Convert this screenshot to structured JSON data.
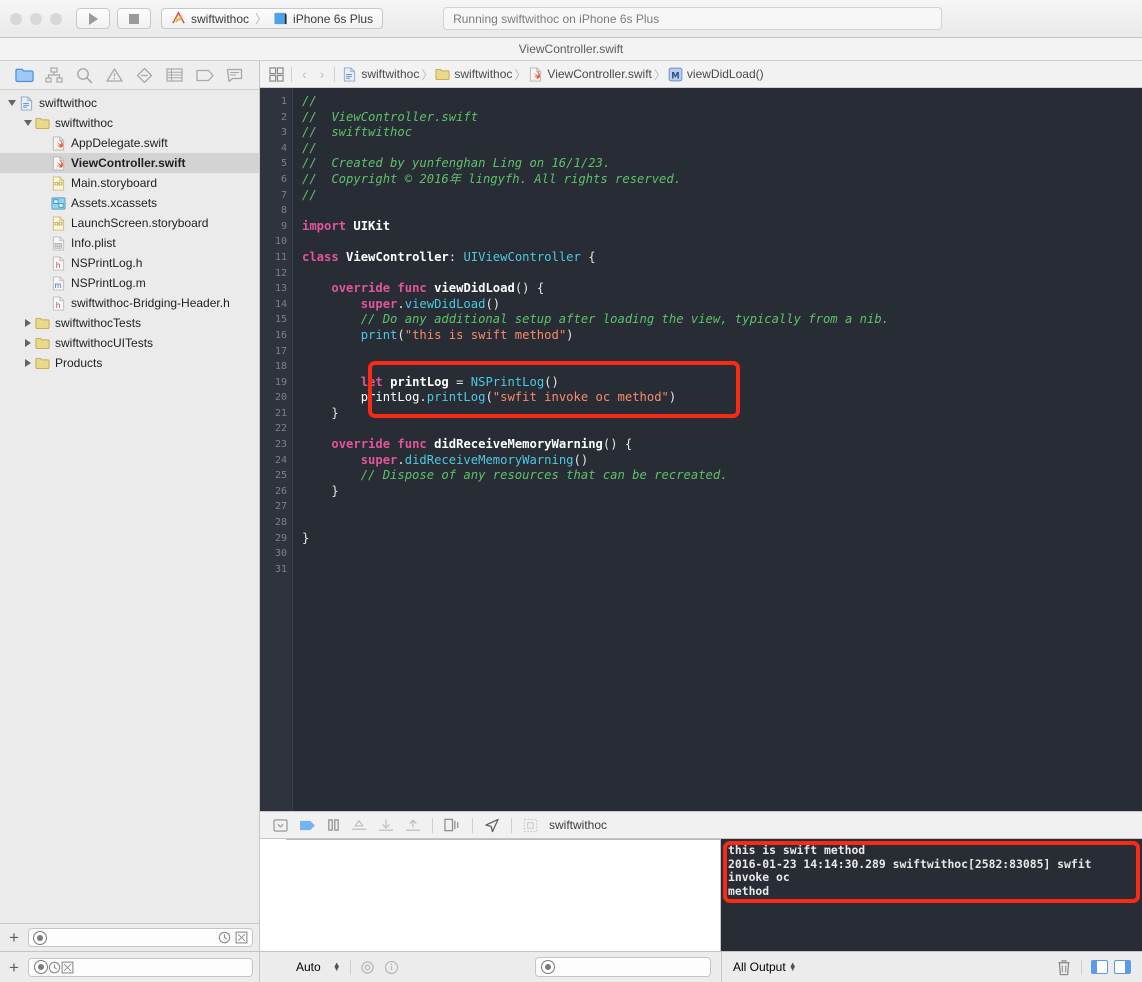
{
  "toolbar": {
    "run_button": "run-button",
    "stop_button": "stop-button",
    "scheme_name": "swiftwithoc",
    "scheme_separator": "〉",
    "destination": "iPhone 6s Plus",
    "status_text": "Running swiftwithoc on iPhone 6s Plus"
  },
  "document_title": "ViewController.swift",
  "navigator": {
    "tabs": [
      {
        "name": "project-navigator",
        "icon": "folder-icon",
        "active": true
      },
      {
        "name": "symbol-navigator",
        "icon": "hierarchy-icon",
        "active": false
      },
      {
        "name": "find-navigator",
        "icon": "search-icon",
        "active": false
      },
      {
        "name": "issue-navigator",
        "icon": "warning-triangle-icon",
        "active": false
      },
      {
        "name": "test-navigator",
        "icon": "diamond-icon",
        "active": false
      },
      {
        "name": "debug-navigator",
        "icon": "list-icon",
        "active": false
      },
      {
        "name": "breakpoint-navigator",
        "icon": "tag-icon",
        "active": false
      },
      {
        "name": "report-navigator",
        "icon": "speech-bubble-icon",
        "active": false
      }
    ],
    "tree": [
      {
        "label": "swiftwithoc",
        "indent": 0,
        "twisty": "open",
        "icon": "project-icon",
        "selected": false
      },
      {
        "label": "swiftwithoc",
        "indent": 1,
        "twisty": "open",
        "icon": "folder-icon",
        "selected": false
      },
      {
        "label": "AppDelegate.swift",
        "indent": 2,
        "twisty": "none",
        "icon": "swift-file-icon",
        "selected": false
      },
      {
        "label": "ViewController.swift",
        "indent": 2,
        "twisty": "none",
        "icon": "swift-file-icon",
        "selected": true
      },
      {
        "label": "Main.storyboard",
        "indent": 2,
        "twisty": "none",
        "icon": "storyboard-icon",
        "selected": false
      },
      {
        "label": "Assets.xcassets",
        "indent": 2,
        "twisty": "none",
        "icon": "assets-icon",
        "selected": false
      },
      {
        "label": "LaunchScreen.storyboard",
        "indent": 2,
        "twisty": "none",
        "icon": "storyboard-icon",
        "selected": false
      },
      {
        "label": "Info.plist",
        "indent": 2,
        "twisty": "none",
        "icon": "plist-icon",
        "selected": false
      },
      {
        "label": "NSPrintLog.h",
        "indent": 2,
        "twisty": "none",
        "icon": "header-file-icon",
        "selected": false
      },
      {
        "label": "NSPrintLog.m",
        "indent": 2,
        "twisty": "none",
        "icon": "objc-file-icon",
        "selected": false
      },
      {
        "label": "swiftwithoc-Bridging-Header.h",
        "indent": 2,
        "twisty": "none",
        "icon": "header-file-icon",
        "selected": false
      },
      {
        "label": "swiftwithocTests",
        "indent": 1,
        "twisty": "closed",
        "icon": "folder-icon",
        "selected": false
      },
      {
        "label": "swiftwithocUITests",
        "indent": 1,
        "twisty": "closed",
        "icon": "folder-icon",
        "selected": false
      },
      {
        "label": "Products",
        "indent": 1,
        "twisty": "closed",
        "icon": "folder-icon",
        "selected": false
      }
    ],
    "filter_placeholder": "",
    "add_button": "+"
  },
  "jumpbar": {
    "related_items_icon": "related-items-icon",
    "back_arrow": "‹",
    "forward_arrow": "›",
    "crumbs": [
      {
        "label": "swiftwithoc",
        "icon": "project-icon"
      },
      {
        "label": "swiftwithoc",
        "icon": "folder-icon"
      },
      {
        "label": "ViewController.swift",
        "icon": "swift-file-icon"
      },
      {
        "label": "viewDidLoad()",
        "icon": "method-icon"
      }
    ]
  },
  "editor": {
    "line_count": 31,
    "lines": [
      [
        {
          "t": "//",
          "c": "cm"
        }
      ],
      [
        {
          "t": "//  ViewController.swift",
          "c": "cm"
        }
      ],
      [
        {
          "t": "//  swiftwithoc",
          "c": "cm"
        }
      ],
      [
        {
          "t": "//",
          "c": "cm"
        }
      ],
      [
        {
          "t": "//  Created by yunfenghan Ling on 16/1/23.",
          "c": "cm"
        }
      ],
      [
        {
          "t": "//  Copyright © 2016年 lingyfh. All rights reserved.",
          "c": "cm"
        }
      ],
      [
        {
          "t": "//",
          "c": "cm"
        }
      ],
      [],
      [
        {
          "t": "import",
          "c": "kw"
        },
        {
          "t": " ",
          "c": "pl"
        },
        {
          "t": "UIKit",
          "c": "fn"
        }
      ],
      [],
      [
        {
          "t": "class",
          "c": "kw"
        },
        {
          "t": " ",
          "c": "pl"
        },
        {
          "t": "ViewController",
          "c": "fn"
        },
        {
          "t": ": ",
          "c": "pl"
        },
        {
          "t": "UIViewController",
          "c": "ty"
        },
        {
          "t": " {",
          "c": "pl"
        }
      ],
      [],
      [
        {
          "t": "    ",
          "c": "pl"
        },
        {
          "t": "override",
          "c": "kw"
        },
        {
          "t": " ",
          "c": "pl"
        },
        {
          "t": "func",
          "c": "kw"
        },
        {
          "t": " ",
          "c": "pl"
        },
        {
          "t": "viewDidLoad",
          "c": "fn"
        },
        {
          "t": "() {",
          "c": "pl"
        }
      ],
      [
        {
          "t": "        ",
          "c": "pl"
        },
        {
          "t": "super",
          "c": "kw"
        },
        {
          "t": ".",
          "c": "pl"
        },
        {
          "t": "viewDidLoad",
          "c": "ty"
        },
        {
          "t": "()",
          "c": "pl"
        }
      ],
      [
        {
          "t": "        // Do any additional setup after loading the view, typically from a nib.",
          "c": "cm"
        }
      ],
      [
        {
          "t": "        ",
          "c": "pl"
        },
        {
          "t": "print",
          "c": "ty"
        },
        {
          "t": "(",
          "c": "pl"
        },
        {
          "t": "\"this is swift method\"",
          "c": "st"
        },
        {
          "t": ")",
          "c": "pl"
        }
      ],
      [],
      [],
      [
        {
          "t": "        ",
          "c": "pl"
        },
        {
          "t": "let",
          "c": "kw"
        },
        {
          "t": " ",
          "c": "pl"
        },
        {
          "t": "printLog",
          "c": "fn"
        },
        {
          "t": " = ",
          "c": "pl"
        },
        {
          "t": "NSPrintLog",
          "c": "ty"
        },
        {
          "t": "()",
          "c": "pl"
        }
      ],
      [
        {
          "t": "        ",
          "c": "pl"
        },
        {
          "t": "printLog",
          "c": "id"
        },
        {
          "t": ".",
          "c": "pl"
        },
        {
          "t": "printLog",
          "c": "ty"
        },
        {
          "t": "(",
          "c": "pl"
        },
        {
          "t": "\"swfit invoke oc method\"",
          "c": "st"
        },
        {
          "t": ")",
          "c": "pl"
        }
      ],
      [
        {
          "t": "    }",
          "c": "pl"
        }
      ],
      [],
      [
        {
          "t": "    ",
          "c": "pl"
        },
        {
          "t": "override",
          "c": "kw"
        },
        {
          "t": " ",
          "c": "pl"
        },
        {
          "t": "func",
          "c": "kw"
        },
        {
          "t": " ",
          "c": "pl"
        },
        {
          "t": "didReceiveMemoryWarning",
          "c": "fn"
        },
        {
          "t": "() {",
          "c": "pl"
        }
      ],
      [
        {
          "t": "        ",
          "c": "pl"
        },
        {
          "t": "super",
          "c": "kw"
        },
        {
          "t": ".",
          "c": "pl"
        },
        {
          "t": "didReceiveMemoryWarning",
          "c": "ty"
        },
        {
          "t": "()",
          "c": "pl"
        }
      ],
      [
        {
          "t": "        // Dispose of any resources that can be recreated.",
          "c": "cm"
        }
      ],
      [
        {
          "t": "    }",
          "c": "pl"
        }
      ],
      [],
      [],
      [
        {
          "t": "}",
          "c": "pl"
        }
      ],
      [],
      []
    ],
    "highlight_color": "#f82a15"
  },
  "debugbar": {
    "hide_icon": "hide-debug-area-icon",
    "continue_icon": "continue-icon",
    "pause_icon": "pause-icon",
    "step_over_icon": "step-over-icon",
    "step_into_icon": "step-into-icon",
    "step_out_icon": "step-out-icon",
    "view_hierarchy_icon": "debug-view-hierarchy-icon",
    "location_icon": "simulate-location-icon",
    "grid_icon": "stack-frame-icon",
    "process_label": "swiftwithoc"
  },
  "console": {
    "lines": [
      "this is swift method",
      "2016-01-23 14:14:30.289 swiftwithoc[2582:83085] swfit invoke oc",
      "method"
    ],
    "highlight_color": "#f82a15"
  },
  "bottombar": {
    "scope_label": "Auto",
    "stepper_icon": "stepper-icon",
    "eye_icon": "eye-icon",
    "info_icon": "info-icon",
    "midsearch_placeholder": "",
    "output_filter_label": "All Output",
    "trash_icon": "trash-icon",
    "left_pane_icon": "variables-pane-toggle-icon",
    "right_pane_icon": "console-pane-toggle-icon"
  }
}
